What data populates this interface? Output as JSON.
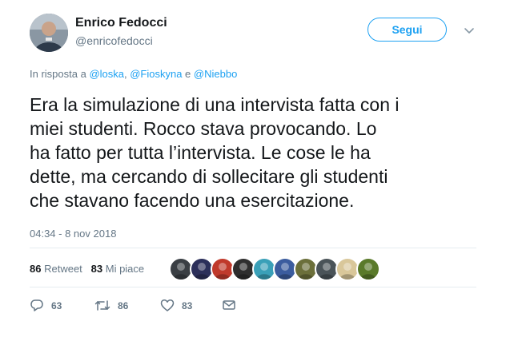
{
  "author": {
    "name": "Enrico Fedocci",
    "handle": "@enricofedocci"
  },
  "follow_label": "Segui",
  "reply_to": {
    "prefix": "In risposta a ",
    "user1": "@loska",
    "sep1": ", ",
    "user2": "@Fioskyna",
    "sep2": " e ",
    "user3": "@Niebbo"
  },
  "tweet_lines": [
    "Era la simulazione di una intervista fatta con i",
    "miei studenti. Rocco stava provocando. Lo",
    "ha fatto per tutta l’intervista. Le cose le ha",
    "dette, ma cercando di sollecitare gli studenti",
    "che stavano facendo una esercitazione."
  ],
  "timestamp": "04:34 - 8 nov 2018",
  "stats": {
    "retweet_count": "86",
    "retweet_label": "Retweet",
    "like_count": "83",
    "like_label": "Mi piace"
  },
  "likers": [
    {
      "icon": "liker-avatar",
      "color": "#3a3f44"
    },
    {
      "icon": "liker-avatar",
      "color": "#2b2f5a"
    },
    {
      "icon": "liker-avatar",
      "color": "#c0392b"
    },
    {
      "icon": "liker-avatar",
      "color": "#2e2e2e"
    },
    {
      "icon": "liker-avatar",
      "color": "#3aa0b8"
    },
    {
      "icon": "liker-avatar",
      "color": "#3b5c9e"
    },
    {
      "icon": "liker-avatar",
      "color": "#6b6f3a"
    },
    {
      "icon": "liker-avatar",
      "color": "#4a5358"
    },
    {
      "icon": "liker-avatar",
      "color": "#d9c79a"
    },
    {
      "icon": "liker-avatar",
      "color": "#5a7a2a"
    }
  ],
  "actions": {
    "replies": "63",
    "retweets": "86",
    "likes": "83"
  },
  "colors": {
    "accent": "#1da1f2",
    "muted": "#657786",
    "text": "#14171a"
  }
}
